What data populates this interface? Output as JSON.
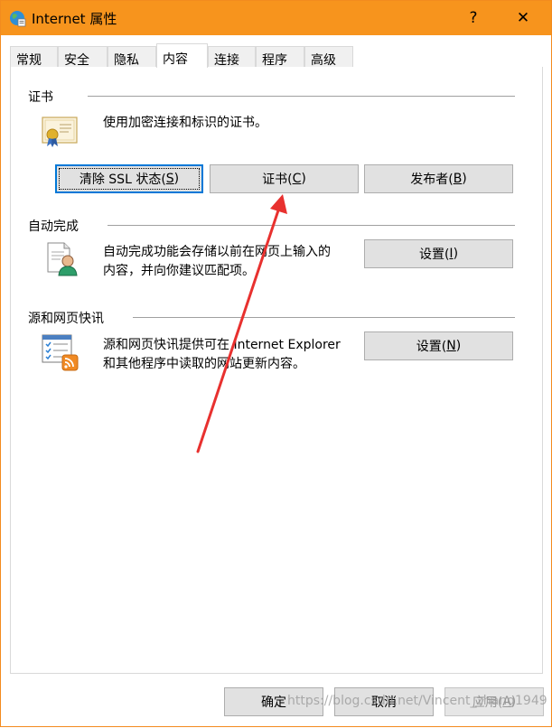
{
  "window": {
    "title": "Internet 属性",
    "help_label": "?",
    "close_label": "✕",
    "app_icon": "internet-options-globe-icon"
  },
  "tabs": [
    "常规",
    "安全",
    "隐私",
    "内容",
    "连接",
    "程序",
    "高级"
  ],
  "active_tab": "内容",
  "certificates": {
    "title": "证书",
    "description": "使用加密连接和标识的证书。",
    "icon": "certificate-icon",
    "clear_ssl": {
      "text": "清除 SSL 状态(",
      "key": "S",
      "tail": ")"
    },
    "certs": {
      "text": "证书(",
      "key": "C",
      "tail": ")"
    },
    "publishers": {
      "text": "发布者(",
      "key": "B",
      "tail": ")"
    }
  },
  "autocomplete": {
    "title": "自动完成",
    "description_line1": "自动完成功能会存储以前在网页上输入的",
    "description_line2": "内容，并向你建议匹配项。",
    "icon": "autocomplete-user-form-icon",
    "settings": {
      "text": "设置(",
      "key": "I",
      "tail": ")"
    }
  },
  "feeds": {
    "title": "源和网页快讯",
    "description_line1": "源和网页快讯提供可在 Internet Explorer",
    "description_line2": "和其他程序中读取的网站更新内容。",
    "icon": "feeds-rss-icon",
    "settings": {
      "text": "设置(",
      "key": "N",
      "tail": ")"
    }
  },
  "footer": {
    "ok": "确定",
    "cancel": "取消",
    "apply": {
      "text": "应用(",
      "key": "A",
      "tail": ")"
    }
  },
  "watermark": "https://blog.csdn.net/Vincent_zhang1949",
  "colors": {
    "titlebar": "#f7941d",
    "focus_border": "#0078d7",
    "annotation_arrow": "#e8312f"
  }
}
